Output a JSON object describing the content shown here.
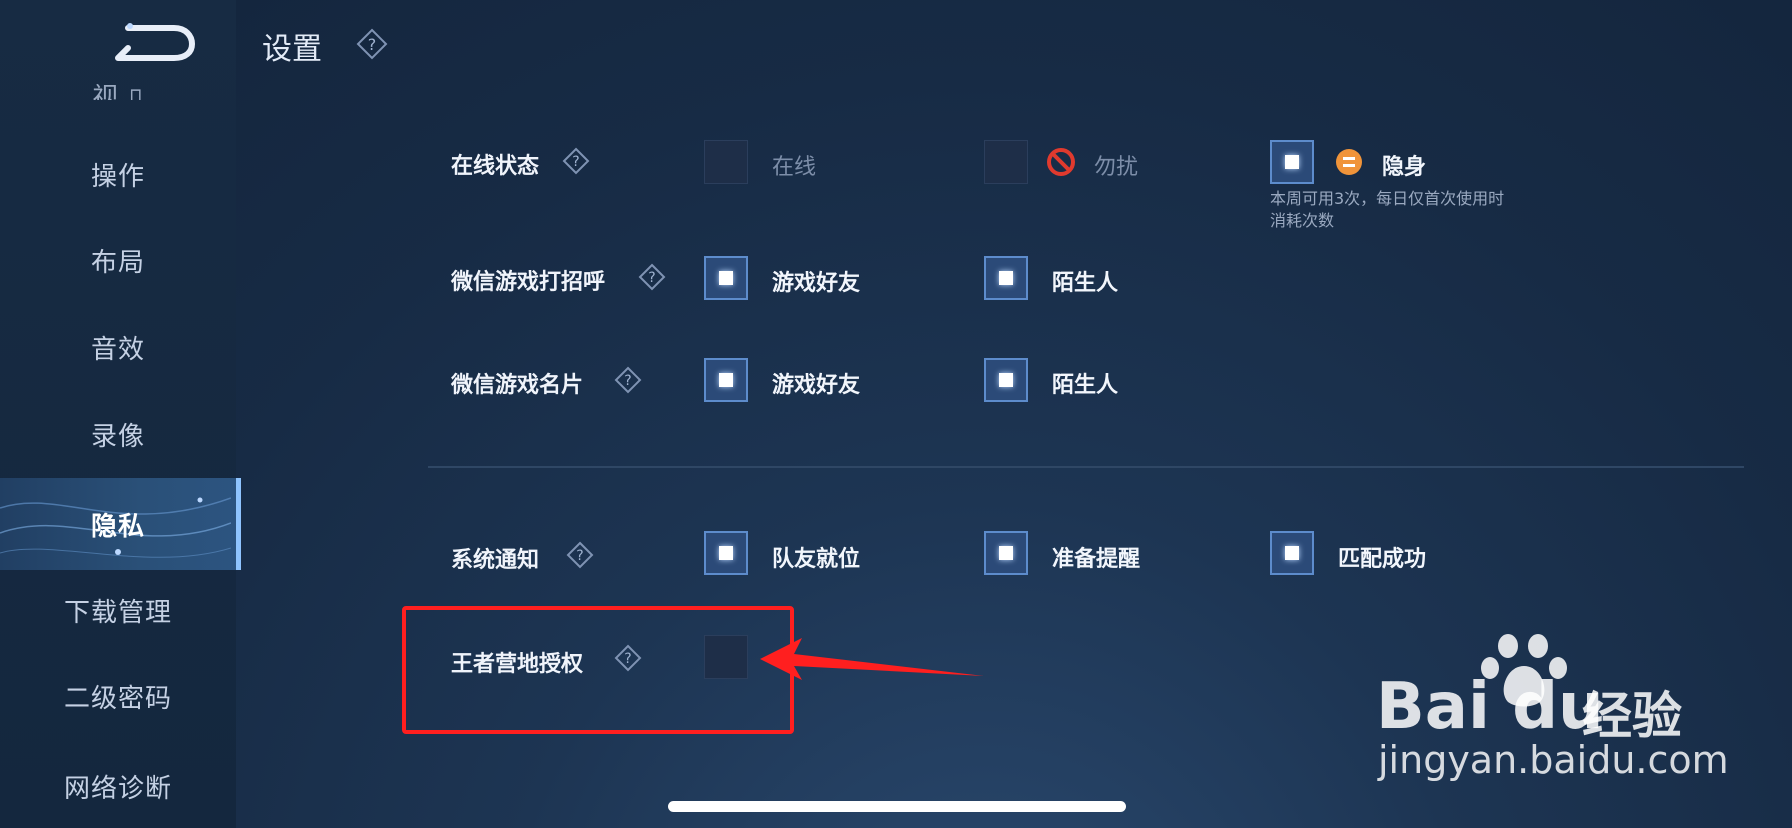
{
  "header": {
    "title": "设置"
  },
  "sidebar": {
    "items": [
      {
        "label": "视 ▯"
      },
      {
        "label": "操作"
      },
      {
        "label": "布局"
      },
      {
        "label": "音效"
      },
      {
        "label": "录像"
      },
      {
        "label": "隐私"
      },
      {
        "label": "下载管理"
      },
      {
        "label": "二级密码"
      },
      {
        "label": "网络诊断"
      }
    ]
  },
  "settings": {
    "online_status": {
      "label": "在线状态",
      "options": [
        {
          "label": "在线",
          "checked": false
        },
        {
          "label": "勿扰",
          "checked": false,
          "icon": "no-entry-icon"
        },
        {
          "label": "隐身",
          "checked": true,
          "icon": "invisible-badge-icon"
        }
      ],
      "note": "本周可用3次，每日仅首次使用时消耗次数"
    },
    "wechat_greeting": {
      "label": "微信游戏打招呼",
      "options": [
        {
          "label": "游戏好友",
          "checked": true
        },
        {
          "label": "陌生人",
          "checked": true
        }
      ]
    },
    "wechat_card": {
      "label": "微信游戏名片",
      "options": [
        {
          "label": "游戏好友",
          "checked": true
        },
        {
          "label": "陌生人",
          "checked": true
        }
      ]
    },
    "system_notify": {
      "label": "系统通知",
      "options": [
        {
          "label": "队友就位",
          "checked": true
        },
        {
          "label": "准备提醒",
          "checked": true
        },
        {
          "label": "匹配成功",
          "checked": true
        }
      ]
    },
    "camp_auth": {
      "label": "王者营地授权",
      "checked": false
    }
  },
  "watermark": {
    "logo": "Bai du",
    "cn": "经验",
    "url": "jingyan.baidu.com"
  },
  "colors": {
    "accent": "#5d8ccc",
    "highlight": "#ff1f1f",
    "dnd": "#e03a2e",
    "invisible": "#f0943a"
  }
}
